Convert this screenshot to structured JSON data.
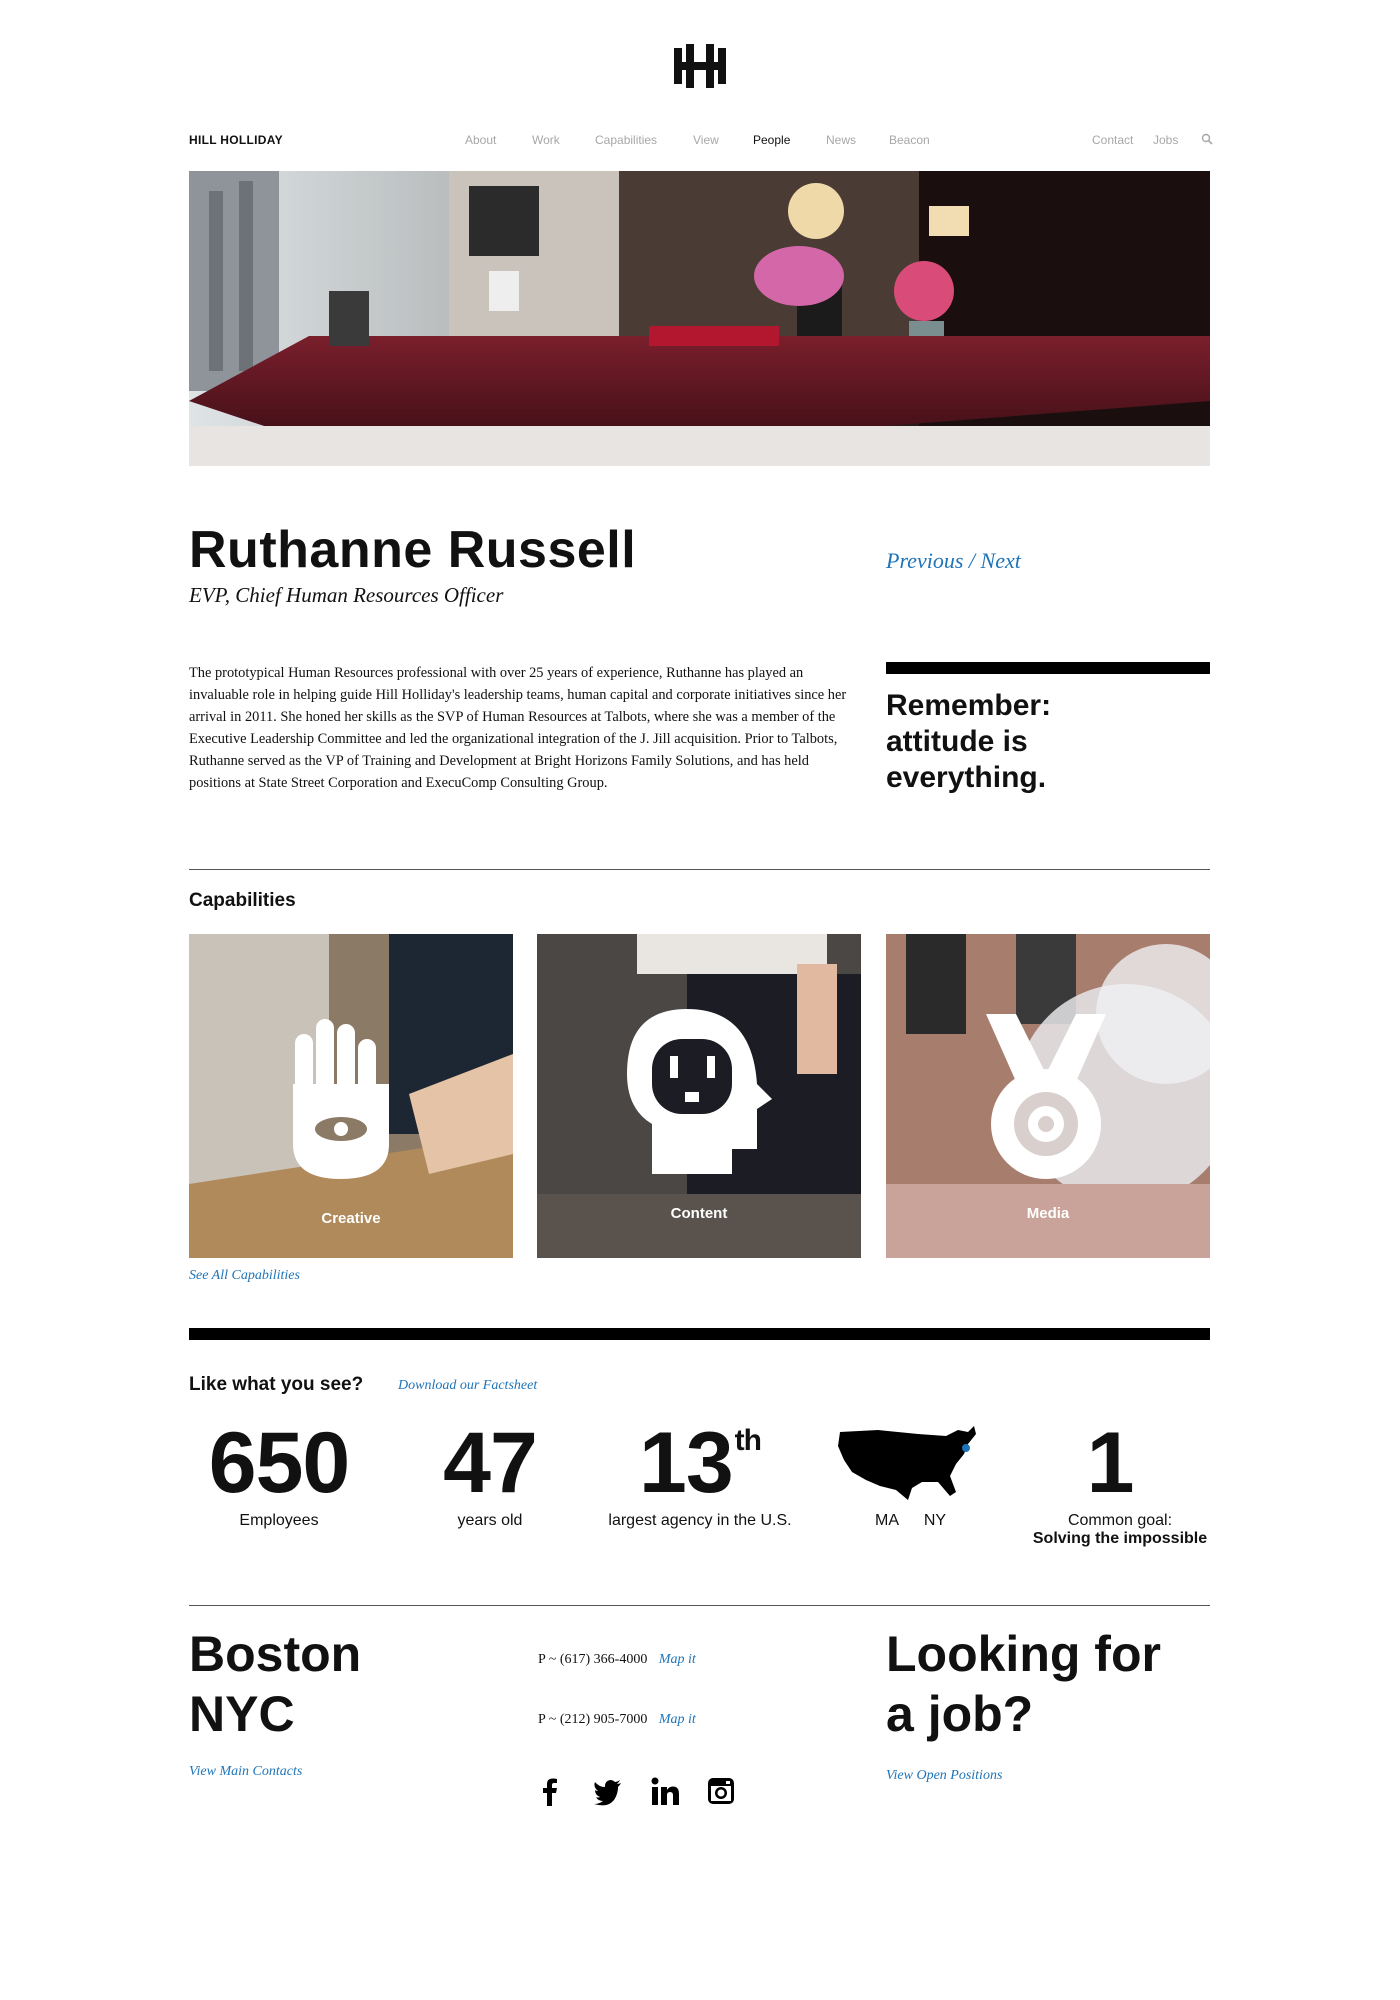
{
  "brand": "HILL HOLLIDAY",
  "nav": {
    "items": [
      "About",
      "Work",
      "Capabilities",
      "View",
      "People",
      "News",
      "Beacon"
    ],
    "active": "People",
    "right": [
      "Contact",
      "Jobs"
    ]
  },
  "profile": {
    "name": "Ruthanne Russell",
    "title": "EVP, Chief Human Resources Officer",
    "previous": "Previous",
    "separator": "/",
    "next": "Next",
    "bio": "The prototypical Human Resources professional with over 25 years of experience, Ruthanne has played an invaluable role in helping guide Hill Holliday's leadership teams, human capital and corporate initiatives since her arrival in 2011. She honed her skills as the SVP of Human Resources at Talbots, where she was a member of the Executive Leadership Committee and led the organizational integration of the J. Jill acquisition. Prior to Talbots, Ruthanne served as the VP of Training and Development at Bright Horizons Family Solutions, and has held positions at State Street Corporation and ExecuComp Consulting Group.",
    "quote_line1": "Remember:",
    "quote_line2": "attitude is",
    "quote_line3": "everything."
  },
  "capabilities": {
    "heading": "Capabilities",
    "cards": [
      "Creative",
      "Content",
      "Media"
    ],
    "see_all": "See All Capabilities"
  },
  "stats": {
    "heading": "Like what you see?",
    "factsheet": "Download our Factsheet",
    "employees_num": "650",
    "employees_label": "Employees",
    "age_num": "47",
    "age_label": "years old",
    "rank_num": "13",
    "rank_sup": "th",
    "rank_label": "largest agency in the U.S.",
    "map_label_ma": "MA",
    "map_label_ny": "NY",
    "goal_num": "1",
    "goal_label": "Common goal:",
    "goal_bold": "Solving the impossible"
  },
  "footer": {
    "city1": "Boston",
    "city2": "NYC",
    "phone1": "P ~ (617) 366-4000",
    "phone2": "P ~ (212) 905-7000",
    "map_it": "Map it",
    "view_contacts": "View Main Contacts",
    "job_line1": "Looking for",
    "job_line2": "a job?",
    "open_positions": "View Open Positions"
  },
  "colors": {
    "link": "#1f74b8",
    "nav_inactive": "#a7a7a7"
  },
  "icons": [
    "hh-logo-icon",
    "search-icon",
    "facebook-icon",
    "twitter-icon",
    "linkedin-icon",
    "instagram-icon",
    "us-map-icon"
  ]
}
